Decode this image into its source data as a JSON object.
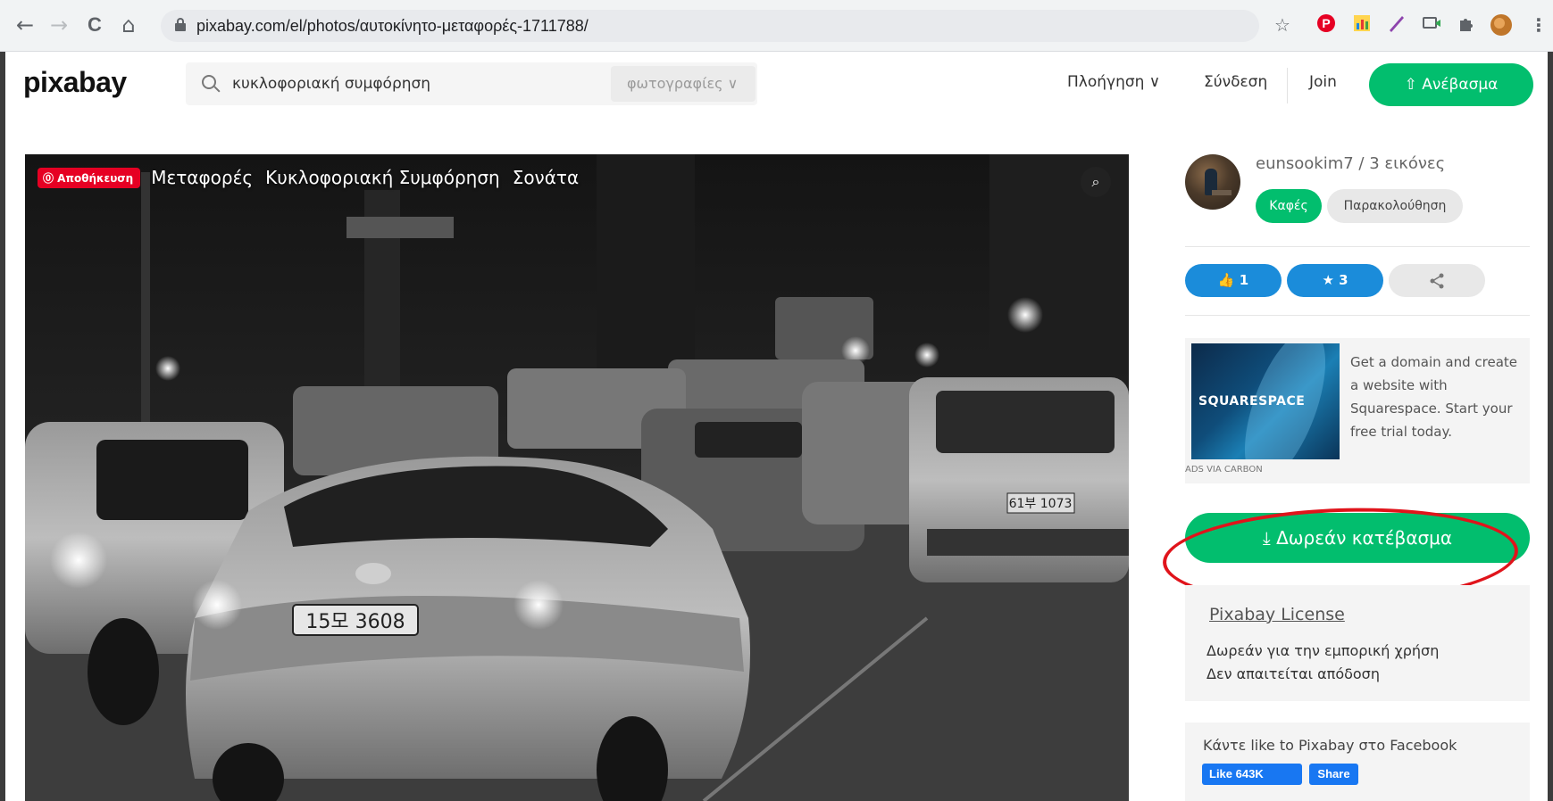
{
  "browser": {
    "url": "pixabay.com/el/photos/αυτοκίνητο-μεταφορές-1711788/",
    "back_icon": "←",
    "forward_icon": "→",
    "reload_icon": "C",
    "home_icon": "⌂",
    "star_icon": "☆",
    "menu_icon": "⋮"
  },
  "header": {
    "logo": "pixabay",
    "search_value": "κυκλοφοριακή συμφόρηση",
    "search_type": "φωτογραφίες ∨",
    "nav_explore": "Πλοήγηση ∨",
    "login": "Σύνδεση",
    "join": "Join",
    "upload": "⇧ Ανέβασμα"
  },
  "photo": {
    "pin_save": "⓪ Αποθήκευση",
    "tags": [
      "Μεταφορές",
      "Κυκλοφοριακή Συμφόρηση",
      "Σονάτα"
    ],
    "zoom_icon": "⌕",
    "plate_front": "15모 3608",
    "plate_right": "61부 1073"
  },
  "sidebar": {
    "username": "eunsookim7 / 3 εικόνες",
    "coffee": "Καφές",
    "follow": "Παρακολούθηση",
    "likes": "1",
    "favorites": "3",
    "ad": {
      "logo": "SQUARESPACE",
      "text": "Get a domain and create a website with Squarespace. Start your free trial today.",
      "via": "ADS VIA CARBON"
    },
    "download": "⤓ Δωρεάν κατέβασμα",
    "license_title": "Pixabay License",
    "license_line1": "Δωρεάν για την εμπορική χρήση",
    "license_line2": "Δεν απαιτείται απόδοση",
    "facebook_text": "Κάντε like to Pixabay στο Facebook",
    "fb_like": "Like 643K",
    "fb_share": "Share"
  },
  "colors": {
    "brand_green": "#02be6e",
    "like_blue": "#1b8cda",
    "annotation_red": "#e0141b",
    "pinterest_red": "#e60023"
  }
}
